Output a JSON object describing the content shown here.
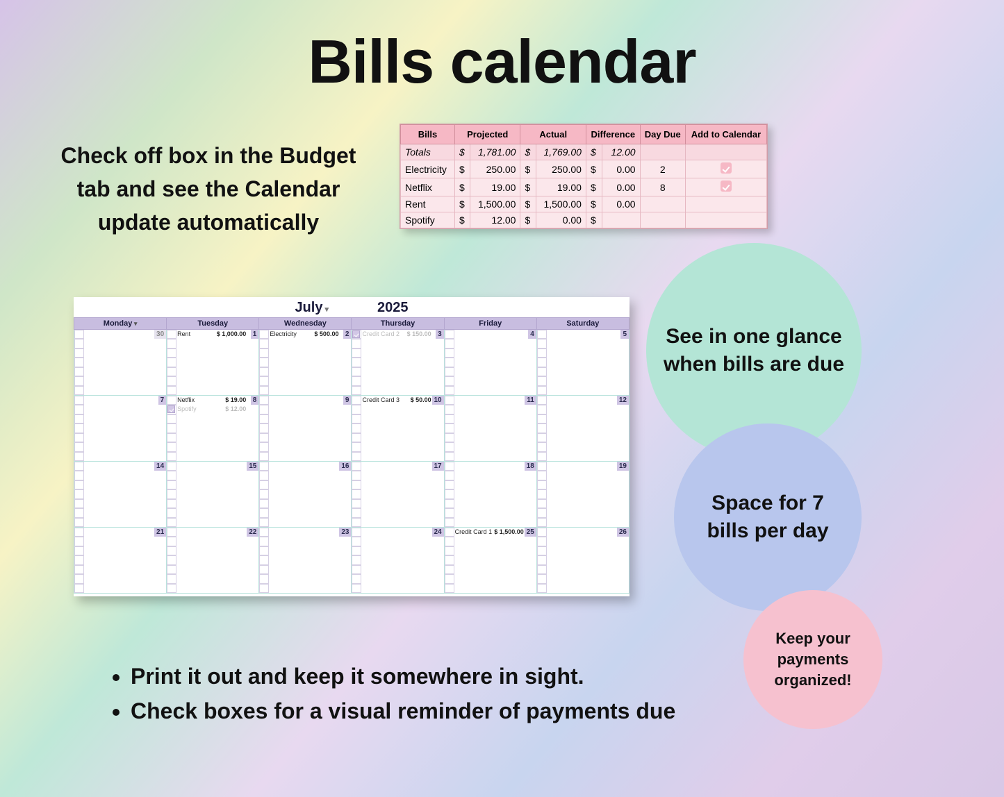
{
  "title": "Bills calendar",
  "subtitle": "Check off box in the Budget tab and see the Calendar update automatically",
  "bills_table": {
    "headers": [
      "Bills",
      "Projected",
      "Actual",
      "Difference",
      "Day Due",
      "Add to Calendar"
    ],
    "totals": {
      "label": "Totals",
      "projected": "1,781.00",
      "actual": "1,769.00",
      "difference": "12.00"
    },
    "rows": [
      {
        "name": "Electricity",
        "projected": "250.00",
        "actual": "250.00",
        "difference": "0.00",
        "day_due": "2",
        "add": true
      },
      {
        "name": "Netflix",
        "projected": "19.00",
        "actual": "19.00",
        "difference": "0.00",
        "day_due": "8",
        "add": true
      },
      {
        "name": "Rent",
        "projected": "1,500.00",
        "actual": "1,500.00",
        "difference": "0.00",
        "day_due": "",
        "add": false
      },
      {
        "name": "Spotify",
        "projected": "12.00",
        "actual": "0.00",
        "difference": "",
        "day_due": "",
        "add": false
      }
    ]
  },
  "calendar": {
    "month": "July",
    "year": "2025",
    "days": [
      "Monday",
      "Tuesday",
      "Wednesday",
      "Thursday",
      "Friday",
      "Saturday"
    ],
    "weeks": [
      [
        {
          "n": "30",
          "mute": true
        },
        {
          "n": "1",
          "entries": [
            {
              "label": "Rent",
              "amt": "$  1,000.00"
            }
          ]
        },
        {
          "n": "2",
          "entries": [
            {
              "label": "Electricity",
              "amt": "$   500.00"
            }
          ]
        },
        {
          "n": "3",
          "entries": [
            {
              "label": "Credit Card 2",
              "amt": "$   150.00",
              "mute": true,
              "checked": true
            }
          ]
        },
        {
          "n": "4"
        },
        {
          "n": "5"
        }
      ],
      [
        {
          "n": "7"
        },
        {
          "n": "8",
          "entries": [
            {
              "label": "Netflix",
              "amt": "$   19.00"
            },
            {
              "label": "Spotify",
              "amt": "$   12.00",
              "mute": true,
              "checked": true
            }
          ]
        },
        {
          "n": "9"
        },
        {
          "n": "10",
          "entries": [
            {
              "label": "Credit Card 3",
              "amt": "$   50.00"
            }
          ]
        },
        {
          "n": "11"
        },
        {
          "n": "12"
        }
      ],
      [
        {
          "n": "14"
        },
        {
          "n": "15"
        },
        {
          "n": "16"
        },
        {
          "n": "17"
        },
        {
          "n": "18"
        },
        {
          "n": "19"
        }
      ],
      [
        {
          "n": "21"
        },
        {
          "n": "22"
        },
        {
          "n": "23"
        },
        {
          "n": "24"
        },
        {
          "n": "25",
          "entries": [
            {
              "label": "Credit Card 1",
              "amt": "$  1,500.00"
            }
          ]
        },
        {
          "n": "26"
        }
      ]
    ]
  },
  "circles": {
    "c1": "See in one glance when bills are due",
    "c2": "Space for 7 bills per day",
    "c3": "Keep your payments organized!"
  },
  "bullets": [
    "Print it out and keep it somewhere in sight.",
    "Check boxes for a visual reminder of payments due"
  ]
}
